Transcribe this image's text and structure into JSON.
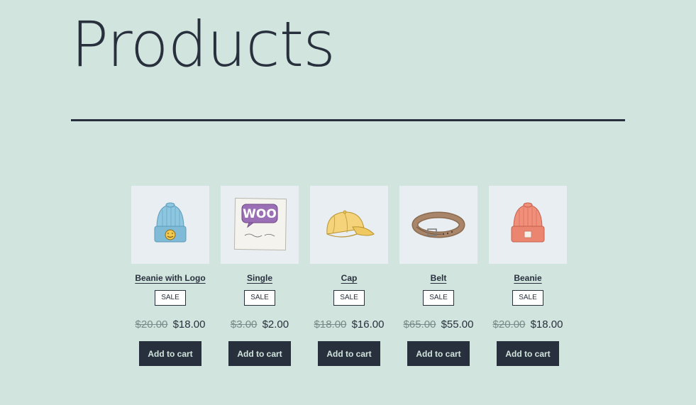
{
  "page": {
    "title": "Products"
  },
  "products": [
    {
      "name": "Beanie with Logo",
      "badge": "SALE",
      "regular_price": "$20.00",
      "sale_price": "$18.00",
      "button_label": "Add to cart",
      "image_icon": "beanie-logo-image"
    },
    {
      "name": "Single",
      "badge": "SALE",
      "regular_price": "$3.00",
      "sale_price": "$2.00",
      "button_label": "Add to cart",
      "image_icon": "woo-single-image",
      "image_text": "WOO"
    },
    {
      "name": "Cap",
      "badge": "SALE",
      "regular_price": "$18.00",
      "sale_price": "$16.00",
      "button_label": "Add to cart",
      "image_icon": "cap-image"
    },
    {
      "name": "Belt",
      "badge": "SALE",
      "regular_price": "$65.00",
      "sale_price": "$55.00",
      "button_label": "Add to cart",
      "image_icon": "belt-image"
    },
    {
      "name": "Beanie",
      "badge": "SALE",
      "regular_price": "$20.00",
      "sale_price": "$18.00",
      "button_label": "Add to cart",
      "image_icon": "beanie-image"
    }
  ],
  "colors": {
    "background": "#d1e4dd",
    "text": "#28303d",
    "button_bg": "#28303d",
    "thumb_bg": "#e9eef2"
  }
}
